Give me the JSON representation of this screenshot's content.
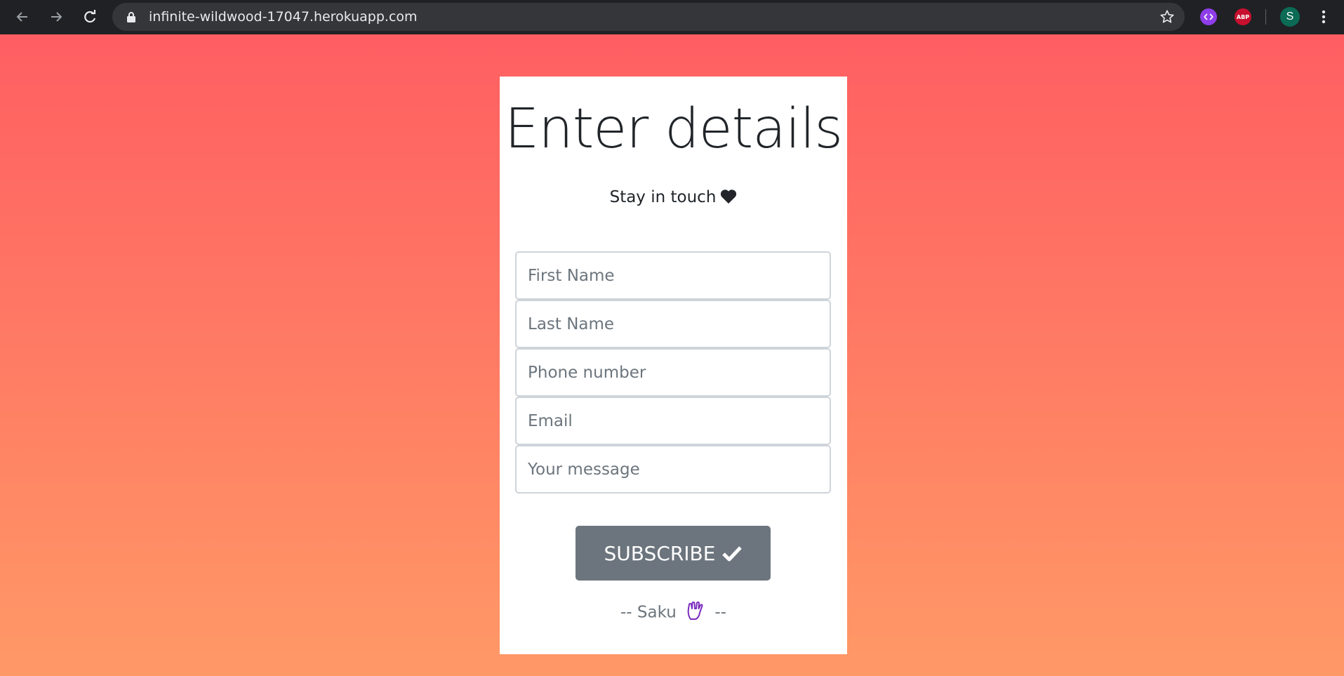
{
  "browser": {
    "url": "infinite-wildwood-17047.herokuapp.com",
    "profile_initial": "S",
    "extensions": [
      "purple-extension-icon",
      "adblock-plus-icon"
    ],
    "extension_abp_label": "ABP"
  },
  "form": {
    "title": "Enter details",
    "subtitle": "Stay in touch",
    "fields": {
      "first_name_placeholder": "First Name",
      "last_name_placeholder": "Last Name",
      "phone_placeholder": "Phone number",
      "email_placeholder": "Email",
      "message_placeholder": "Your message"
    },
    "submit_label": "SUBSCRIBE",
    "signature_prefix": "-- Saku",
    "signature_suffix": "--"
  },
  "colors": {
    "gradient_top": "#ff5e62",
    "gradient_bottom": "#ff9966",
    "button_bg": "#6c757d",
    "hand_icon": "#7b2cbf"
  }
}
